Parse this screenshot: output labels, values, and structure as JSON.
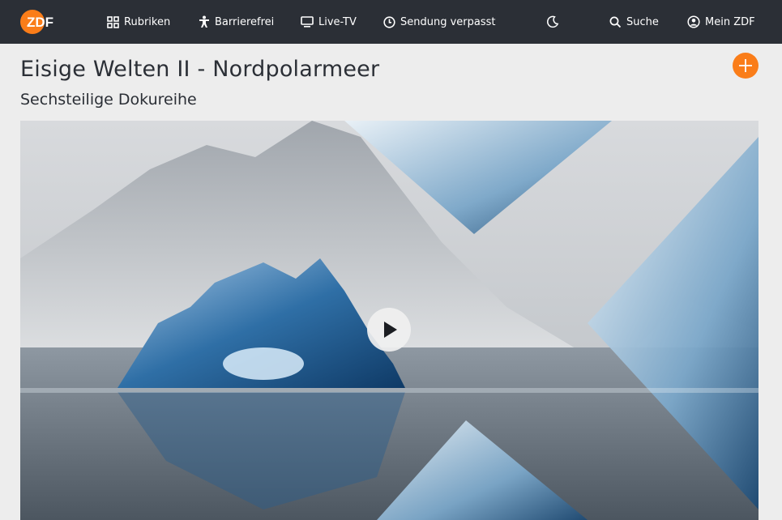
{
  "brand": {
    "logo_text": "ZDF",
    "accent": "#fa7d19",
    "header_bg": "#2b2f36"
  },
  "nav": {
    "rubriken": "Rubriken",
    "barrierefrei": "Barrierefrei",
    "livetv": "Live-TV",
    "verpasst": "Sendung verpasst",
    "suche": "Suche",
    "mein_zdf": "Mein ZDF"
  },
  "page": {
    "title": "Eisige Welten II - Nordpolarmeer",
    "subtitle": "Sechsteilige Dokureihe"
  },
  "icons": {
    "theme_toggle": "moon-icon",
    "add": "plus-icon",
    "play": "play-icon"
  }
}
